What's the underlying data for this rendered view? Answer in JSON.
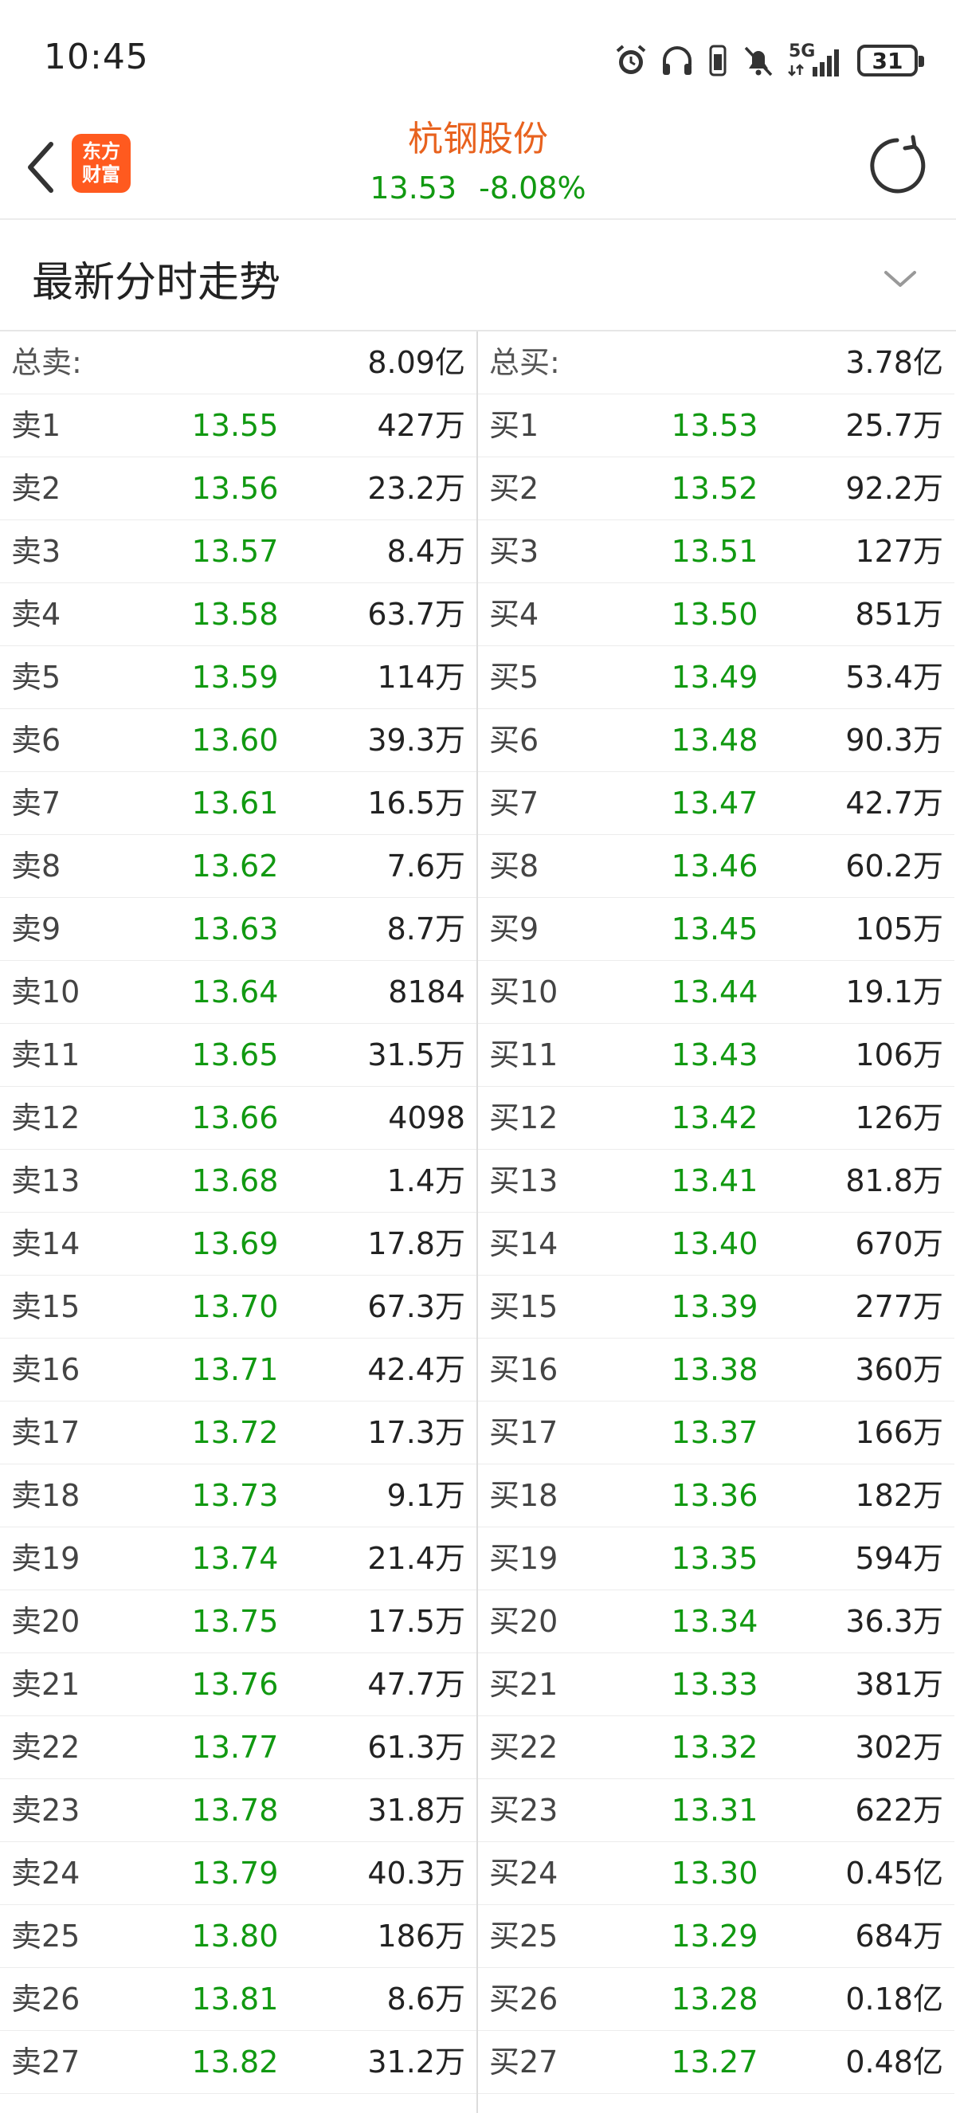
{
  "status_bar": {
    "time": "10:45",
    "network": "5G",
    "battery": "31",
    "icons": [
      "alarm-icon",
      "headphones-icon",
      "vibrate-icon",
      "mute-icon",
      "signal-icon",
      "battery-icon"
    ]
  },
  "header": {
    "logo_line1": "东方",
    "logo_line2": "财富",
    "stock_name": "杭钢股份",
    "price": "13.53",
    "change": "-8.08%",
    "colors": {
      "name": "#e8621e",
      "down": "#119911",
      "logo_bg": "#ff5a1f"
    }
  },
  "section": {
    "title": "最新分时走势"
  },
  "order_book": {
    "sell_total_label": "总卖:",
    "sell_total_value": "8.09亿",
    "buy_total_label": "总买:",
    "buy_total_value": "3.78亿",
    "sell": [
      {
        "label": "卖1",
        "price": "13.55",
        "volume": "427万"
      },
      {
        "label": "卖2",
        "price": "13.56",
        "volume": "23.2万"
      },
      {
        "label": "卖3",
        "price": "13.57",
        "volume": "8.4万"
      },
      {
        "label": "卖4",
        "price": "13.58",
        "volume": "63.7万"
      },
      {
        "label": "卖5",
        "price": "13.59",
        "volume": "114万"
      },
      {
        "label": "卖6",
        "price": "13.60",
        "volume": "39.3万"
      },
      {
        "label": "卖7",
        "price": "13.61",
        "volume": "16.5万"
      },
      {
        "label": "卖8",
        "price": "13.62",
        "volume": "7.6万"
      },
      {
        "label": "卖9",
        "price": "13.63",
        "volume": "8.7万"
      },
      {
        "label": "卖10",
        "price": "13.64",
        "volume": "8184"
      },
      {
        "label": "卖11",
        "price": "13.65",
        "volume": "31.5万"
      },
      {
        "label": "卖12",
        "price": "13.66",
        "volume": "4098"
      },
      {
        "label": "卖13",
        "price": "13.68",
        "volume": "1.4万"
      },
      {
        "label": "卖14",
        "price": "13.69",
        "volume": "17.8万"
      },
      {
        "label": "卖15",
        "price": "13.70",
        "volume": "67.3万"
      },
      {
        "label": "卖16",
        "price": "13.71",
        "volume": "42.4万"
      },
      {
        "label": "卖17",
        "price": "13.72",
        "volume": "17.3万"
      },
      {
        "label": "卖18",
        "price": "13.73",
        "volume": "9.1万"
      },
      {
        "label": "卖19",
        "price": "13.74",
        "volume": "21.4万"
      },
      {
        "label": "卖20",
        "price": "13.75",
        "volume": "17.5万"
      },
      {
        "label": "卖21",
        "price": "13.76",
        "volume": "47.7万"
      },
      {
        "label": "卖22",
        "price": "13.77",
        "volume": "61.3万"
      },
      {
        "label": "卖23",
        "price": "13.78",
        "volume": "31.8万"
      },
      {
        "label": "卖24",
        "price": "13.79",
        "volume": "40.3万"
      },
      {
        "label": "卖25",
        "price": "13.80",
        "volume": "186万"
      },
      {
        "label": "卖26",
        "price": "13.81",
        "volume": "8.6万"
      },
      {
        "label": "卖27",
        "price": "13.82",
        "volume": "31.2万"
      }
    ],
    "buy": [
      {
        "label": "买1",
        "price": "13.53",
        "volume": "25.7万"
      },
      {
        "label": "买2",
        "price": "13.52",
        "volume": "92.2万"
      },
      {
        "label": "买3",
        "price": "13.51",
        "volume": "127万"
      },
      {
        "label": "买4",
        "price": "13.50",
        "volume": "851万"
      },
      {
        "label": "买5",
        "price": "13.49",
        "volume": "53.4万"
      },
      {
        "label": "买6",
        "price": "13.48",
        "volume": "90.3万"
      },
      {
        "label": "买7",
        "price": "13.47",
        "volume": "42.7万"
      },
      {
        "label": "买8",
        "price": "13.46",
        "volume": "60.2万"
      },
      {
        "label": "买9",
        "price": "13.45",
        "volume": "105万"
      },
      {
        "label": "买10",
        "price": "13.44",
        "volume": "19.1万"
      },
      {
        "label": "买11",
        "price": "13.43",
        "volume": "106万"
      },
      {
        "label": "买12",
        "price": "13.42",
        "volume": "126万"
      },
      {
        "label": "买13",
        "price": "13.41",
        "volume": "81.8万"
      },
      {
        "label": "买14",
        "price": "13.40",
        "volume": "670万"
      },
      {
        "label": "买15",
        "price": "13.39",
        "volume": "277万"
      },
      {
        "label": "买16",
        "price": "13.38",
        "volume": "360万"
      },
      {
        "label": "买17",
        "price": "13.37",
        "volume": "166万"
      },
      {
        "label": "买18",
        "price": "13.36",
        "volume": "182万"
      },
      {
        "label": "买19",
        "price": "13.35",
        "volume": "594万"
      },
      {
        "label": "买20",
        "price": "13.34",
        "volume": "36.3万"
      },
      {
        "label": "买21",
        "price": "13.33",
        "volume": "381万"
      },
      {
        "label": "买22",
        "price": "13.32",
        "volume": "302万"
      },
      {
        "label": "买23",
        "price": "13.31",
        "volume": "622万"
      },
      {
        "label": "买24",
        "price": "13.30",
        "volume": "0.45亿"
      },
      {
        "label": "买25",
        "price": "13.29",
        "volume": "684万"
      },
      {
        "label": "买26",
        "price": "13.28",
        "volume": "0.18亿"
      },
      {
        "label": "买27",
        "price": "13.27",
        "volume": "0.48亿"
      }
    ]
  }
}
